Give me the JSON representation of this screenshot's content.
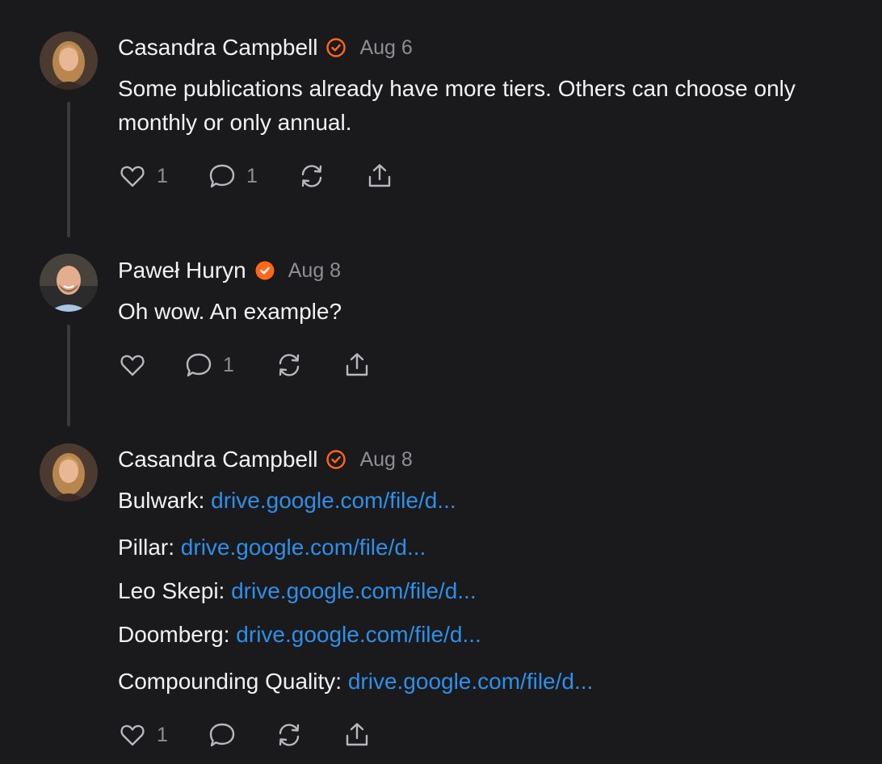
{
  "comments": [
    {
      "author": "Casandra Campbell",
      "date": "Aug 6",
      "text": "Some publications already have more tiers. Others can choose only monthly or only annual.",
      "likes": "1",
      "replies": "1"
    },
    {
      "author": "Paweł Huryn",
      "date": "Aug 8",
      "text": "Oh wow. An example?",
      "likes": "",
      "replies": "1"
    },
    {
      "author": "Casandra Campbell",
      "date": "Aug 8",
      "links": [
        {
          "label": "Bulwark:",
          "url": "drive.google.com/file/d..."
        },
        {
          "label": "Pillar:",
          "url": "drive.google.com/file/d..."
        },
        {
          "label": "Leo Skepi:",
          "url": "drive.google.com/file/d..."
        },
        {
          "label": "Doomberg:",
          "url": "drive.google.com/file/d..."
        },
        {
          "label": "Compounding Quality:",
          "url": "drive.google.com/file/d..."
        }
      ],
      "likes": "1",
      "replies": ""
    }
  ],
  "colors": {
    "background": "#1a1a1c",
    "badge_orange": "#ff6719",
    "link_blue": "#2e8fe8",
    "muted_text": "#8e8e93"
  },
  "icons": {
    "like": "heart-icon",
    "reply": "speech-bubble-icon",
    "restack": "restack-icon",
    "share": "share-icon",
    "verified": "verified-badge-icon"
  }
}
